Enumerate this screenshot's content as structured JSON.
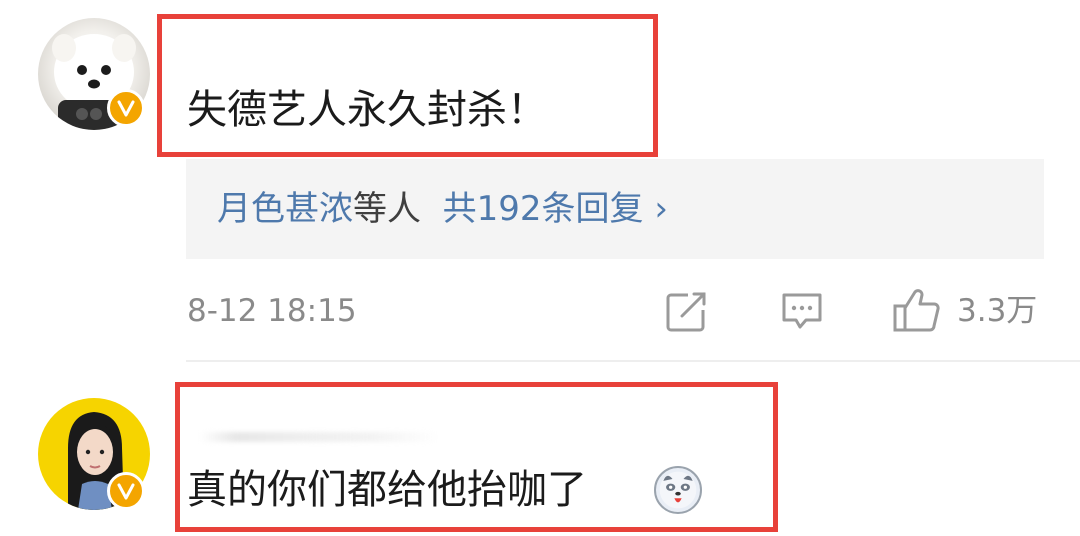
{
  "comments": [
    {
      "text": "失德艺人永久封杀！",
      "replies": {
        "user": "月色甚浓",
        "mid": "等人",
        "count": "共192条回复",
        "chevron": "›"
      },
      "time": "8-12 18:15",
      "likes": "3.3万",
      "icons": [
        "share-icon",
        "comment-icon",
        "like-icon"
      ]
    },
    {
      "text": "真的你们都给他抬咖了",
      "emoji": "dog-emoji"
    }
  ],
  "colors": {
    "highlight": "#e8413a",
    "link": "#4e79ac",
    "meta": "#8a8a8a",
    "badge": "#f4a500"
  }
}
